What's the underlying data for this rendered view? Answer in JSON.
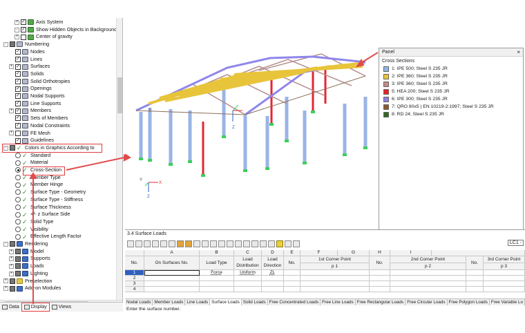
{
  "navigator": {
    "items": [
      {
        "id": "axis-system",
        "label": "Axis System",
        "indent": 3,
        "type": "check",
        "icon": "green",
        "expander": "+"
      },
      {
        "id": "show-hidden",
        "label": "Show Hidden Objects in Background",
        "indent": 3,
        "type": "check",
        "icon": "green",
        "expander": "-"
      },
      {
        "id": "center-gravity",
        "label": "Center of gravity",
        "indent": 3,
        "type": "check-empty",
        "icon": "green",
        "expander": "+"
      },
      {
        "id": "numbering",
        "label": "Numbering",
        "indent": 1,
        "type": "check-partial",
        "icon": "grp",
        "expander": "-"
      },
      {
        "id": "nodes",
        "label": "Nodes",
        "indent": 2,
        "type": "check",
        "icon": "grp",
        "expander": ""
      },
      {
        "id": "lines",
        "label": "Lines",
        "indent": 2,
        "type": "check",
        "icon": "grp",
        "expander": ""
      },
      {
        "id": "surfaces",
        "label": "Surfaces",
        "indent": 2,
        "type": "check",
        "icon": "grp",
        "expander": "+"
      },
      {
        "id": "solids",
        "label": "Solids",
        "indent": 2,
        "type": "check",
        "icon": "grp",
        "expander": ""
      },
      {
        "id": "solid-ortho",
        "label": "Solid Orthotropies",
        "indent": 2,
        "type": "check",
        "icon": "grp",
        "expander": ""
      },
      {
        "id": "openings",
        "label": "Openings",
        "indent": 2,
        "type": "check",
        "icon": "grp",
        "expander": ""
      },
      {
        "id": "nodal-supports",
        "label": "Nodal Supports",
        "indent": 2,
        "type": "check",
        "icon": "grp",
        "expander": ""
      },
      {
        "id": "line-supports",
        "label": "Line Supports",
        "indent": 2,
        "type": "check",
        "icon": "grp",
        "expander": ""
      },
      {
        "id": "members",
        "label": "Members",
        "indent": 2,
        "type": "check",
        "icon": "grp",
        "expander": "+"
      },
      {
        "id": "sets-members",
        "label": "Sets of Members",
        "indent": 2,
        "type": "check",
        "icon": "grp",
        "expander": ""
      },
      {
        "id": "nodal-constraints",
        "label": "Nodal Constraints",
        "indent": 2,
        "type": "check",
        "icon": "grp",
        "expander": ""
      },
      {
        "id": "fe-mesh",
        "label": "FE Mesh",
        "indent": 2,
        "type": "check-empty",
        "icon": "grp",
        "expander": "+"
      },
      {
        "id": "guidelines",
        "label": "Guidelines",
        "indent": 2,
        "type": "check",
        "icon": "grp",
        "expander": ""
      },
      {
        "id": "colors-graphics",
        "label": "Colors in Graphics According to",
        "indent": 1,
        "type": "check-partial",
        "icon": "check",
        "expander": "-"
      },
      {
        "id": "standard",
        "label": "Standard",
        "indent": 2,
        "type": "radio",
        "icon": "check",
        "expander": ""
      },
      {
        "id": "material",
        "label": "Material",
        "indent": 2,
        "type": "radio",
        "icon": "check",
        "expander": ""
      },
      {
        "id": "cross-section",
        "label": "Cross-Section",
        "indent": 2,
        "type": "radio-on",
        "icon": "check",
        "expander": ""
      },
      {
        "id": "member-type",
        "label": "Member Type",
        "indent": 2,
        "type": "radio",
        "icon": "check",
        "expander": ""
      },
      {
        "id": "member-hinge",
        "label": "Member Hinge",
        "indent": 2,
        "type": "radio",
        "icon": "check",
        "expander": ""
      },
      {
        "id": "surface-type-geometry",
        "label": "Surface Type - Geometry",
        "indent": 2,
        "type": "radio",
        "icon": "check",
        "expander": ""
      },
      {
        "id": "surface-type-stiffness",
        "label": "Surface Type - Stiffness",
        "indent": 2,
        "type": "radio",
        "icon": "check",
        "expander": ""
      },
      {
        "id": "surface-thickness",
        "label": "Surface Thickness",
        "indent": 2,
        "type": "radio",
        "icon": "check",
        "expander": ""
      },
      {
        "id": "surface-side",
        "label": "+/- z Surface Side",
        "indent": 2,
        "type": "radio",
        "icon": "check",
        "expander": ""
      },
      {
        "id": "solid-type",
        "label": "Solid Type",
        "indent": 2,
        "type": "radio",
        "icon": "check",
        "expander": ""
      },
      {
        "id": "visibility",
        "label": "Visibility",
        "indent": 2,
        "type": "radio",
        "icon": "check",
        "expander": ""
      },
      {
        "id": "effective-length",
        "label": "Effective Length Factor",
        "indent": 2,
        "type": "radio",
        "icon": "check",
        "expander": ""
      },
      {
        "id": "rendering",
        "label": "Rendering",
        "indent": 1,
        "type": "check-partial",
        "icon": "blue",
        "expander": "-"
      },
      {
        "id": "model",
        "label": "Model",
        "indent": 2,
        "type": "check-partial",
        "icon": "blue",
        "expander": "+"
      },
      {
        "id": "supports",
        "label": "Supports",
        "indent": 2,
        "type": "check-partial",
        "icon": "blue",
        "expander": "+"
      },
      {
        "id": "loads",
        "label": "Loads",
        "indent": 2,
        "type": "check-partial",
        "icon": "blue",
        "expander": "+"
      },
      {
        "id": "lighting",
        "label": "Lighting",
        "indent": 2,
        "type": "check-partial",
        "icon": "blue",
        "expander": "+"
      },
      {
        "id": "preselection",
        "label": "Preselection",
        "indent": 1,
        "type": "check-partial",
        "icon": "yellow",
        "expander": "+"
      },
      {
        "id": "add-on-modules",
        "label": "Add-on Modules",
        "indent": 1,
        "type": "check-partial",
        "icon": "blue",
        "expander": "+"
      }
    ],
    "tabs": [
      {
        "id": "data",
        "label": "Data"
      },
      {
        "id": "display",
        "label": "Display"
      },
      {
        "id": "views",
        "label": "Views"
      }
    ]
  },
  "panel": {
    "title": "Panel",
    "close": "×",
    "subtitle": "Cross Sections",
    "items": [
      {
        "label": "1: IPE 500; Steel S 235 JR",
        "color": "#8fb4e3"
      },
      {
        "label": "2: IPE 360; Steel S 235 JR",
        "color": "#e8c43a"
      },
      {
        "label": "3: IPE 360; Steel S 235 JR",
        "color": "#c48a8a"
      },
      {
        "label": "5: HEA 200; Steel S 235 JR",
        "color": "#e8222a"
      },
      {
        "label": "6: IPE 300; Steel S 235 JR",
        "color": "#8c7fe0"
      },
      {
        "label": "7: QRO 80x5 | EN 10219-2:1997; Steel S 235 JR",
        "color": "#8a5a2a"
      },
      {
        "label": "8: RD 24; Steel S 235 JR",
        "color": "#2f6a1e"
      }
    ]
  },
  "table": {
    "title": "3.4 Surface Loads",
    "lc": "LC1 -",
    "columns": {
      "a": "A",
      "b": "B",
      "c": "C",
      "d": "D",
      "e": "E",
      "f": "F",
      "g": "G",
      "h": "H",
      "i": "I",
      "no": "No.",
      "on_surfaces": "On Surfaces No.",
      "load_type": "Load Type",
      "load_dist_1": "Load",
      "load_dist_2": "Distribution",
      "load_dir_1": "Load",
      "load_dir_2": "Direction",
      "no_e": "No.",
      "corner1": "1st Corner Point",
      "p1": "p 1",
      "no_h": "No.",
      "corner2": "2nd Corner Point",
      "p2": "p 2",
      "no_k": "No.",
      "corner3": "3rd Corner Point",
      "p3": "p 3"
    },
    "rows": [
      {
        "no": "1",
        "surfaces": "",
        "type": "Force",
        "dist": "Uniform",
        "dir": "ZL"
      },
      {
        "no": "2",
        "surfaces": "",
        "type": "",
        "dist": "",
        "dir": ""
      },
      {
        "no": "3",
        "surfaces": "",
        "type": "",
        "dist": "",
        "dir": ""
      },
      {
        "no": "4",
        "surfaces": "",
        "type": "",
        "dist": "",
        "dir": ""
      }
    ]
  },
  "bottom_tabs": [
    {
      "label": "Nodal Loads"
    },
    {
      "label": "Member Loads"
    },
    {
      "label": "Line Loads"
    },
    {
      "label": "Surface Loads",
      "active": true
    },
    {
      "label": "Solid Loads"
    },
    {
      "label": "Free Concentrated Loads"
    },
    {
      "label": "Free Line Loads"
    },
    {
      "label": "Free Rectangular Loads"
    },
    {
      "label": "Free Circular Loads"
    },
    {
      "label": "Free Polygon Loads"
    },
    {
      "label": "Free Variable Lo"
    }
  ],
  "status": "Enter the surface number.",
  "axes": {
    "x": "X",
    "y": "Y",
    "z": "Z"
  }
}
